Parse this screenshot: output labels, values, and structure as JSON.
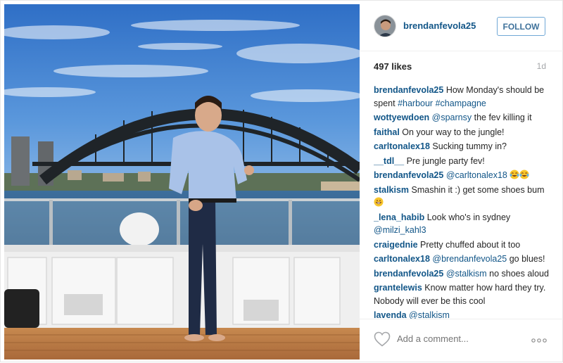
{
  "post": {
    "username": "brendanfevola25",
    "follow_label": "FOLLOW",
    "likes": "497 likes",
    "time_ago": "1d"
  },
  "comments": [
    {
      "user": "brendanfevola25",
      "parts": [
        {
          "t": "text",
          "v": "How Monday's should be spent "
        },
        {
          "t": "tag",
          "v": "#harbour"
        },
        {
          "t": "text",
          "v": " "
        },
        {
          "t": "tag",
          "v": "#champagne"
        }
      ]
    },
    {
      "user": "wottyewdoen",
      "parts": [
        {
          "t": "mention",
          "v": "@sparnsy"
        },
        {
          "t": "text",
          "v": " the fev killing it"
        }
      ]
    },
    {
      "user": "faithal",
      "parts": [
        {
          "t": "text",
          "v": "On your way to the jungle!"
        }
      ]
    },
    {
      "user": "carltonalex18",
      "parts": [
        {
          "t": "text",
          "v": "Sucking tummy in?"
        }
      ]
    },
    {
      "user": "__tdl__",
      "parts": [
        {
          "t": "text",
          "v": "Pre jungle party fev!"
        }
      ]
    },
    {
      "user": "brendanfevola25",
      "parts": [
        {
          "t": "mention",
          "v": "@carltonalex18"
        },
        {
          "t": "text",
          "v": " "
        },
        {
          "t": "emoji",
          "v": "laughing-tears"
        },
        {
          "t": "emoji",
          "v": "laughing-tears"
        }
      ]
    },
    {
      "user": "stalkism",
      "parts": [
        {
          "t": "text",
          "v": "Smashin it :) get some shoes bum "
        },
        {
          "t": "emoji",
          "v": "grin"
        }
      ]
    },
    {
      "user": "_lena_habib",
      "parts": [
        {
          "t": "text",
          "v": "Look who's in sydney "
        },
        {
          "t": "mention",
          "v": "@milzi_kahl3"
        }
      ]
    },
    {
      "user": "craigednie",
      "parts": [
        {
          "t": "text",
          "v": "Pretty chuffed about it too"
        }
      ]
    },
    {
      "user": "carltonalex18",
      "parts": [
        {
          "t": "mention",
          "v": "@brendanfevola25"
        },
        {
          "t": "text",
          "v": " go blues!"
        }
      ]
    },
    {
      "user": "brendanfevola25",
      "parts": [
        {
          "t": "mention",
          "v": "@stalkism"
        },
        {
          "t": "text",
          "v": " no shoes aloud"
        }
      ]
    },
    {
      "user": "grantelewis",
      "parts": [
        {
          "t": "text",
          "v": "Know matter how hard they try. Nobody will ever be this cool"
        }
      ]
    },
    {
      "user": "lavenda",
      "parts": [
        {
          "t": "mention",
          "v": "@stalkism"
        }
      ]
    }
  ],
  "footer": {
    "comment_placeholder": "Add a comment...",
    "like_icon": "heart-outline-icon",
    "more_icon": "ellipsis-icon"
  },
  "colors": {
    "link_blue": "#125688",
    "follow_border": "#70a8d6",
    "muted_gray": "#a5a7aa",
    "sky": "#3f7fd0"
  }
}
